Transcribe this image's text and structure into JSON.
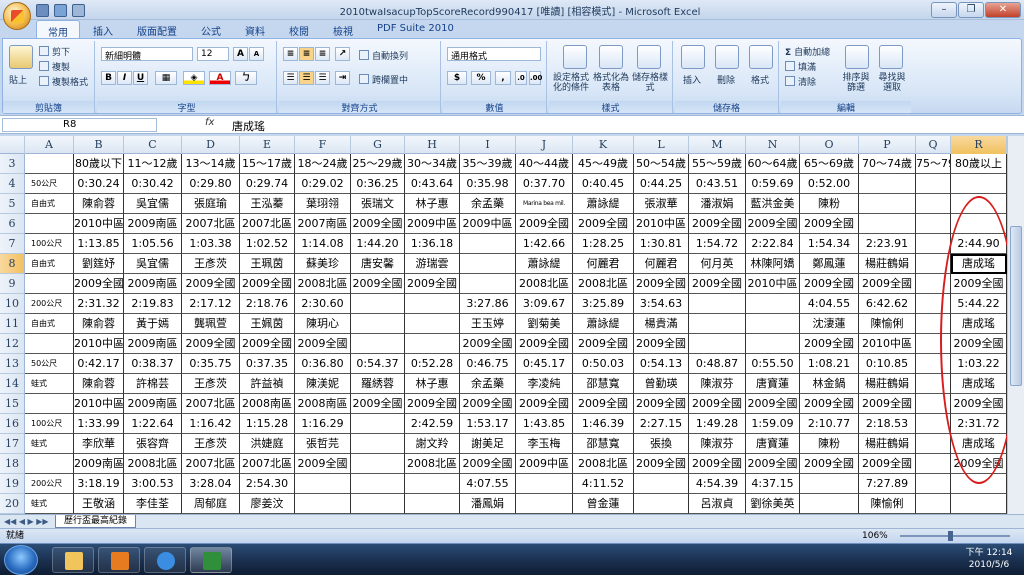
{
  "window": {
    "title": "2010twaIsacupTopScoreRecord990417  [唯讀]  [相容模式] - Microsoft Excel",
    "min": "–",
    "max": "❐",
    "close": "✕"
  },
  "tabs": [
    "常用",
    "插入",
    "版面配置",
    "公式",
    "資料",
    "校閱",
    "檢視",
    "PDF Suite 2010"
  ],
  "ribbon": {
    "clipboard": {
      "paste": "貼上",
      "cut": "剪下",
      "copy": "複製",
      "format_painter": "複製格式",
      "label": "剪貼簿"
    },
    "font": {
      "family": "新細明體",
      "size": "12",
      "label": "字型",
      "bold": "B",
      "italic": "I",
      "underline": "U"
    },
    "alignment": {
      "wrap": "自動換列",
      "merge": "跨欄置中",
      "label": "對齊方式"
    },
    "number": {
      "format": "通用格式",
      "currency": "$",
      "percent": "%",
      "comma": ",",
      "label": "數值"
    },
    "styles": {
      "conditional": "設定格式化的條件",
      "as_table": "格式化為表格",
      "cell_styles": "儲存格樣式",
      "label": "樣式"
    },
    "cells": {
      "insert": "插入",
      "delete": "刪除",
      "format": "格式",
      "label": "儲存格"
    },
    "editing": {
      "autosum": "自動加總",
      "fill": "填滿",
      "clear": "清除",
      "sort": "排序與篩選",
      "find": "尋找與選取",
      "label": "編輯"
    }
  },
  "formula_bar": {
    "name_box": "R8",
    "fx": "fx",
    "content": "唐成瑤"
  },
  "columns": [
    "A",
    "B",
    "C",
    "D",
    "E",
    "F",
    "G",
    "H",
    "I",
    "J",
    "K",
    "L",
    "M",
    "N",
    "O",
    "P",
    "Q",
    "R"
  ],
  "rows": [
    {
      "n": "3",
      "cells": [
        "",
        "80歲以下",
        "11～12歲",
        "13～14歲",
        "15～17歲",
        "18～24歲",
        "25～29歲",
        "30～34歲",
        "35～39歲",
        "40～44歲",
        "45～49歲",
        "50～54歲",
        "55～59歲",
        "60～64歲",
        "65～69歲",
        "70～74歲",
        "75～79歲",
        "80歲以上"
      ]
    },
    {
      "n": "4",
      "cells": [
        "50公尺",
        "0:30.24",
        "0:30.42",
        "0:29.80",
        "0:29.74",
        "0:29.02",
        "0:36.25",
        "0:43.64",
        "0:35.98",
        "0:37.70",
        "0:40.45",
        "0:44.25",
        "0:43.51",
        "0:59.69",
        "0:52.00",
        "",
        "",
        ""
      ]
    },
    {
      "n": "5",
      "cells": [
        "自由式",
        "陳俞蓉",
        "吳宜儒",
        "張庭瑜",
        "王泓蓁",
        "葉珝翎",
        "張瑞文",
        "林子惠",
        "余孟藥",
        "Marina bea mil.",
        "蕭詠緹",
        "張淑華",
        "潘淑娟",
        "藍洪金美",
        "陳粉",
        "",
        "",
        ""
      ]
    },
    {
      "n": "6",
      "cells": [
        "",
        "2010中區",
        "2009南區",
        "2007北區",
        "2007北區",
        "2007南區",
        "2009全國",
        "2009中區",
        "2009中區",
        "2009全國",
        "2009全國",
        "2010中區",
        "2009全國",
        "2009全國",
        "2009全國",
        "",
        "",
        ""
      ]
    },
    {
      "n": "7",
      "cells": [
        "100公尺",
        "1:13.85",
        "1:05.56",
        "1:03.38",
        "1:02.52",
        "1:14.08",
        "1:44.20",
        "1:36.18",
        "",
        "1:42.66",
        "1:28.25",
        "1:30.81",
        "1:54.72",
        "2:22.84",
        "1:54.34",
        "2:23.91",
        "",
        "2:44.90"
      ]
    },
    {
      "n": "8",
      "cells": [
        "自由式",
        "劉筳妤",
        "吳宜儒",
        "王彥茨",
        "王珮茵",
        "蘇美珍",
        "唐安馨",
        "游瑞雲",
        "",
        "蕭詠緹",
        "何麗君",
        "何麗君",
        "何月英",
        "林陳阿嬌",
        "鄭鳳蓮",
        "楊莊鶴娟",
        "",
        "唐成瑤"
      ]
    },
    {
      "n": "9",
      "cells": [
        "",
        "2009全國",
        "2009南區",
        "2009全國",
        "2009全國",
        "2008北區",
        "2009全國",
        "2009全國",
        "",
        "2008北區",
        "2008北區",
        "2009全國",
        "2009全國",
        "2010中區",
        "2009全國",
        "2009全國",
        "",
        "2009全國"
      ]
    },
    {
      "n": "10",
      "cells": [
        "200公尺",
        "2:31.32",
        "2:19.83",
        "2:17.12",
        "2:18.76",
        "2:30.60",
        "",
        "",
        "3:27.86",
        "3:09.67",
        "3:25.89",
        "3:54.63",
        "",
        "",
        "4:04.55",
        "6:42.62",
        "",
        "5:44.22"
      ]
    },
    {
      "n": "11",
      "cells": [
        "自由式",
        "陳俞蓉",
        "黃于嫣",
        "龔珮萱",
        "王姵茵",
        "陳玥心",
        "",
        "",
        "王玉婷",
        "劉菊美",
        "蕭詠緹",
        "楊貴滿",
        "",
        "",
        "沈淒蓮",
        "陳愉俐",
        "",
        "唐成瑤"
      ]
    },
    {
      "n": "12",
      "cells": [
        "",
        "2010中區",
        "2009南區",
        "2009全國",
        "2009全國",
        "2009全國",
        "",
        "",
        "2009全國",
        "2009全國",
        "2009全國",
        "2009全國",
        "",
        "",
        "2009全國",
        "2010中區",
        "",
        "2009全國"
      ]
    },
    {
      "n": "13",
      "cells": [
        "50公尺",
        "0:42.17",
        "0:38.37",
        "0:35.75",
        "0:37.35",
        "0:36.80",
        "0:54.37",
        "0:52.28",
        "0:46.75",
        "0:45.17",
        "0:50.03",
        "0:54.13",
        "0:48.87",
        "0:55.50",
        "1:08.21",
        "0:10.85",
        "",
        "1:03.22"
      ]
    },
    {
      "n": "14",
      "cells": [
        "蛙式",
        "陳俞蓉",
        "許棉芸",
        "王彥茨",
        "許益禎",
        "陳渼妮",
        "羅綉蓉",
        "林子惠",
        "余孟藥",
        "李凌純",
        "邵慧寬",
        "曾勤瑛",
        "陳淑芬",
        "唐寶蓮",
        "林金鍋",
        "楊莊鶴娟",
        "",
        "唐成瑤"
      ]
    },
    {
      "n": "15",
      "cells": [
        "",
        "2010中區",
        "2009南區",
        "2007北區",
        "2008南區",
        "2008南區",
        "2009全國",
        "2009全國",
        "2009全國",
        "2009全國",
        "2009全國",
        "2009全國",
        "2009全國",
        "2009全國",
        "2009全國",
        "2009全國",
        "",
        "2009全國"
      ]
    },
    {
      "n": "16",
      "cells": [
        "100公尺",
        "1:33.99",
        "1:22.64",
        "1:16.42",
        "1:15.28",
        "1:16.29",
        "",
        "2:42.59",
        "1:53.17",
        "1:43.85",
        "1:46.39",
        "2:27.15",
        "1:49.28",
        "1:59.09",
        "2:10.77",
        "2:18.53",
        "",
        "2:31.72"
      ]
    },
    {
      "n": "17",
      "cells": [
        "蛙式",
        "李欣華",
        "張容齊",
        "王彥茨",
        "洪婕庭",
        "張哲芫",
        "",
        "謝文羚",
        "謝美足",
        "李玉梅",
        "邵慧寬",
        "張換",
        "陳淑芬",
        "唐寶蓮",
        "陳粉",
        "楊莊鶴娟",
        "",
        "唐成瑤"
      ]
    },
    {
      "n": "18",
      "cells": [
        "",
        "2009南區",
        "2008北區",
        "2007北區",
        "2007北區",
        "2009全國",
        "",
        "2008北區",
        "2009全國",
        "2009中區",
        "2008北區",
        "2009全國",
        "2009全國",
        "2009全國",
        "2009全國",
        "2009全國",
        "",
        "2009全國"
      ]
    },
    {
      "n": "19",
      "cells": [
        "200公尺",
        "3:18.19",
        "3:00.53",
        "3:28.04",
        "2:54.30",
        "",
        "",
        "",
        "4:07.55",
        "",
        "4:11.52",
        "",
        "4:54.39",
        "4:37.15",
        "",
        "7:27.89",
        "",
        ""
      ]
    },
    {
      "n": "20",
      "cells": [
        "蛙式",
        "王敬涵",
        "李佳荃",
        "周郁庭",
        "廖姜汶",
        "",
        "",
        "",
        "潘鳳娟",
        "",
        "曾金蓮",
        "",
        "呂淑貞",
        "劉徐美英",
        "",
        "陳愉俐",
        "",
        ""
      ]
    }
  ],
  "sheet_tab": "歷行盃最高紀錄",
  "status": {
    "ready": "就緒",
    "zoom": "106%"
  },
  "clock": {
    "time": "下午 12:14",
    "date": "2010/5/6"
  }
}
